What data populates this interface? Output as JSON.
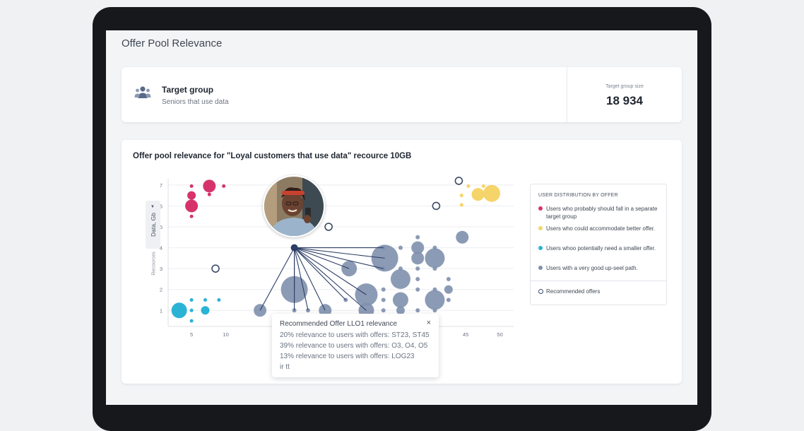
{
  "page": {
    "title": "Offer Pool Relevance"
  },
  "target_group": {
    "title": "Target group",
    "subtitle": "Seniors that use data",
    "size_label": "Target group size",
    "size_value": "18 934"
  },
  "chart_card": {
    "title": "Offer pool relevance for \"Loyal customers that use data\" recource 10GB",
    "y_selector": "Data, Gb",
    "y_secondary": "Recources"
  },
  "legend": {
    "title": "USER DISTRIBUTION BY OFFER",
    "items": [
      {
        "label": "Users who probably should fall in a separate target group",
        "color": "#d6336c"
      },
      {
        "label": "Users who could accommodate better offer.",
        "color": "#f5d46a"
      },
      {
        "label": "Users whoo potentially need a smaller offer.",
        "color": "#2bb3d6"
      },
      {
        "label": "Users with a very good up-seel path.",
        "color": "#8090ad"
      }
    ],
    "recommended": "Recommended offers"
  },
  "tooltip": {
    "title": "Recommended Offer LLO1 relevance",
    "close": "×",
    "lines": [
      "20% relevance to users with offers: ST23, ST45",
      "39% relevance to users with offers:  O3, O4, O5",
      "13% relevance to users with offers:  LOG23",
      "ir tt"
    ]
  },
  "chart_data": {
    "type": "scatter",
    "title": "Offer pool relevance for \"Loyal customers that use data\" recource 10GB",
    "xlabel": "",
    "ylabel": "Data, Gb",
    "x_ticks": [
      5,
      10,
      45,
      50
    ],
    "y_ticks": [
      1,
      2,
      3,
      4,
      5,
      6,
      7
    ],
    "xlim": [
      2,
      52
    ],
    "ylim": [
      0.3,
      7.3
    ],
    "grid": true,
    "legend_position": "right",
    "colors": {
      "pink": "#d6336c",
      "yellow": "#f5d46a",
      "cyan": "#2bb3d6",
      "slate": "#8090ad",
      "hub": "#2c3e66",
      "ring": "#3a4a66"
    },
    "series": [
      {
        "name": "Users who probably should fall in a separate target group",
        "color": "pink",
        "points": [
          {
            "x": 5.0,
            "y": 6.0,
            "r": 9
          },
          {
            "x": 5.0,
            "y": 6.5,
            "r": 6
          },
          {
            "x": 5.0,
            "y": 5.5,
            "r": 2.5
          },
          {
            "x": 5.0,
            "y": 6.95,
            "r": 2.5
          },
          {
            "x": 7.6,
            "y": 6.95,
            "r": 9
          },
          {
            "x": 7.6,
            "y": 6.55,
            "r": 2.5
          },
          {
            "x": 9.7,
            "y": 6.95,
            "r": 2.5
          }
        ]
      },
      {
        "name": "Users who could accommodate better offer.",
        "color": "yellow",
        "points": [
          {
            "x": 46.8,
            "y": 6.55,
            "r": 9
          },
          {
            "x": 48.8,
            "y": 6.6,
            "r": 12
          },
          {
            "x": 45.4,
            "y": 6.95,
            "r": 2.5
          },
          {
            "x": 47.6,
            "y": 6.95,
            "r": 2.5
          },
          {
            "x": 44.4,
            "y": 6.5,
            "r": 2.5
          },
          {
            "x": 44.4,
            "y": 6.05,
            "r": 2.5
          }
        ]
      },
      {
        "name": "Users whoo potentially need a smaller offer.",
        "color": "cyan",
        "points": [
          {
            "x": 3.2,
            "y": 1.0,
            "r": 11
          },
          {
            "x": 7.0,
            "y": 1.0,
            "r": 6
          },
          {
            "x": 5.0,
            "y": 0.5,
            "r": 2.5
          },
          {
            "x": 5.0,
            "y": 1.0,
            "r": 2.5
          },
          {
            "x": 5.0,
            "y": 1.5,
            "r": 2.5
          },
          {
            "x": 7.0,
            "y": 1.5,
            "r": 2.5
          },
          {
            "x": 9.0,
            "y": 1.5,
            "r": 2.5
          }
        ]
      },
      {
        "name": "Users with a very good up-seel path.",
        "color": "slate",
        "points": [
          {
            "x": 15.0,
            "y": 1.0,
            "r": 9
          },
          {
            "x": 20.0,
            "y": 1.0,
            "r": 3
          },
          {
            "x": 22.0,
            "y": 1.0,
            "r": 3
          },
          {
            "x": 24.5,
            "y": 1.0,
            "r": 9
          },
          {
            "x": 20.0,
            "y": 2.0,
            "r": 19
          },
          {
            "x": 27.5,
            "y": 1.5,
            "r": 3
          },
          {
            "x": 28.0,
            "y": 3.0,
            "r": 11
          },
          {
            "x": 30.5,
            "y": 1.0,
            "r": 11
          },
          {
            "x": 30.5,
            "y": 1.75,
            "r": 16
          },
          {
            "x": 33.2,
            "y": 3.5,
            "r": 19
          },
          {
            "x": 33.0,
            "y": 4.0,
            "r": 3
          },
          {
            "x": 33.0,
            "y": 3.0,
            "r": 3
          },
          {
            "x": 33.0,
            "y": 2.0,
            "r": 3
          },
          {
            "x": 33.0,
            "y": 1.5,
            "r": 3
          },
          {
            "x": 33.0,
            "y": 1.0,
            "r": 3
          },
          {
            "x": 35.5,
            "y": 2.5,
            "r": 14
          },
          {
            "x": 35.5,
            "y": 1.5,
            "r": 11
          },
          {
            "x": 35.5,
            "y": 1.0,
            "r": 6
          },
          {
            "x": 35.5,
            "y": 0.5,
            "r": 3
          },
          {
            "x": 35.5,
            "y": 3.0,
            "r": 3
          },
          {
            "x": 35.5,
            "y": 4.0,
            "r": 3
          },
          {
            "x": 38.0,
            "y": 3.5,
            "r": 9
          },
          {
            "x": 38.0,
            "y": 4.0,
            "r": 9
          },
          {
            "x": 38.0,
            "y": 4.5,
            "r": 3
          },
          {
            "x": 38.0,
            "y": 3.0,
            "r": 3
          },
          {
            "x": 38.0,
            "y": 2.5,
            "r": 3
          },
          {
            "x": 38.0,
            "y": 2.0,
            "r": 3
          },
          {
            "x": 38.0,
            "y": 1.0,
            "r": 3
          },
          {
            "x": 38.0,
            "y": 0.5,
            "r": 3
          },
          {
            "x": 40.5,
            "y": 3.5,
            "r": 14
          },
          {
            "x": 40.5,
            "y": 4.0,
            "r": 3
          },
          {
            "x": 40.5,
            "y": 3.0,
            "r": 3
          },
          {
            "x": 40.5,
            "y": 2.0,
            "r": 3
          },
          {
            "x": 40.5,
            "y": 1.5,
            "r": 14
          },
          {
            "x": 40.5,
            "y": 1.0,
            "r": 3
          },
          {
            "x": 42.5,
            "y": 2.5,
            "r": 3
          },
          {
            "x": 42.5,
            "y": 2.0,
            "r": 6
          },
          {
            "x": 42.5,
            "y": 1.5,
            "r": 3
          },
          {
            "x": 44.5,
            "y": 4.5,
            "r": 9
          }
        ]
      }
    ],
    "recommended_offers": [
      {
        "x": 8.5,
        "y": 3.0
      },
      {
        "x": 25.0,
        "y": 5.0
      },
      {
        "x": 40.7,
        "y": 6.0
      },
      {
        "x": 44.0,
        "y": 7.2
      }
    ],
    "hub": {
      "x": 20.0,
      "y": 4.0,
      "links_to": [
        0,
        1,
        2,
        3,
        4,
        5,
        6,
        7,
        8,
        9,
        10,
        11
      ]
    }
  }
}
